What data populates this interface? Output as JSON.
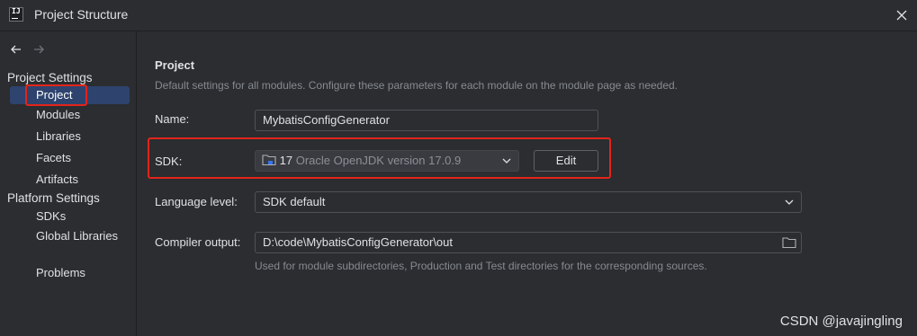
{
  "window": {
    "title": "Project Structure",
    "app_icon_text": "IJ"
  },
  "sidebar": {
    "section_project_settings": "Project Settings",
    "project_items": [
      {
        "label": "Project",
        "selected": true
      },
      {
        "label": "Modules"
      },
      {
        "label": "Libraries"
      },
      {
        "label": "Facets"
      },
      {
        "label": "Artifacts"
      }
    ],
    "section_platform_settings": "Platform Settings",
    "platform_items": [
      {
        "label": "SDKs"
      },
      {
        "label": "Global Libraries"
      }
    ],
    "problems_label": "Problems"
  },
  "main": {
    "title": "Project",
    "description": "Default settings for all modules. Configure these parameters for each module on the module page as needed.",
    "name_label": "Name:",
    "name_value": "MybatisConfigGenerator",
    "sdk_label": "SDK:",
    "sdk_version": "17",
    "sdk_name": "Oracle OpenJDK version 17.0.9",
    "edit_button": "Edit",
    "language_level_label": "Language level:",
    "language_level_value": "SDK default",
    "compiler_output_label": "Compiler output:",
    "compiler_output_value": "D:\\code\\MybatisConfigGenerator\\out",
    "compiler_output_hint": "Used for module subdirectories, Production and Test directories for the corresponding sources."
  },
  "watermark": "CSDN @javajingling",
  "colors": {
    "background": "#2b2d30",
    "selection": "#2e436e",
    "highlight_box": "#e3241b",
    "text": "#dfe1e5",
    "muted": "#868a91"
  }
}
